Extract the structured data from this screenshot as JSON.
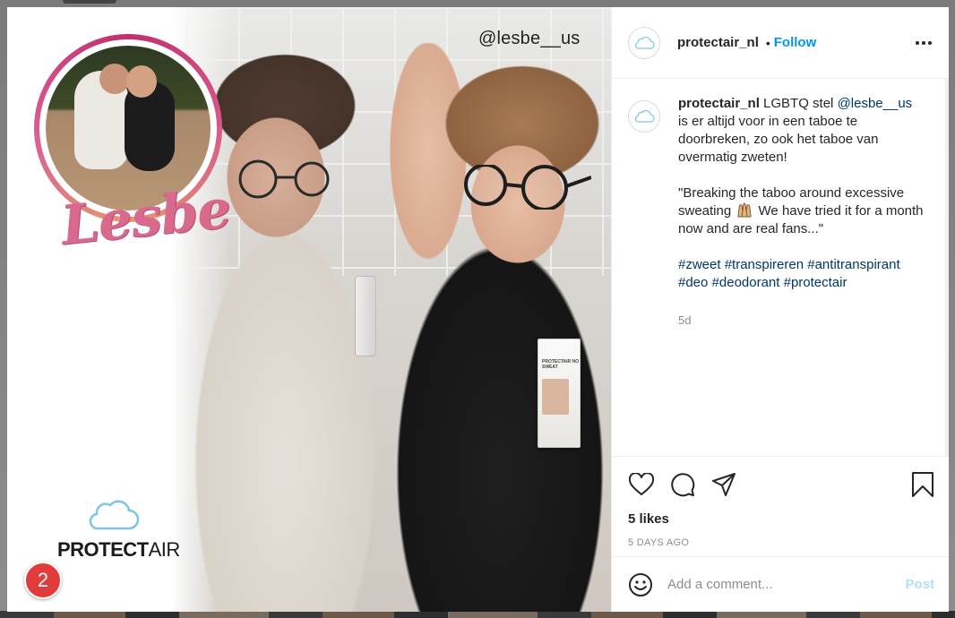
{
  "post": {
    "image": {
      "watermark_handle": "@lesbe__us",
      "badge_script_text": "Lesbe",
      "brand_name_bold": "PROTECT",
      "brand_name_thin": "AIR",
      "product_text": "PROTECTAIR NO SWEAT",
      "brand_cloud_icon": "cloud-icon"
    },
    "notification_count": "2"
  },
  "header": {
    "username": "protectair_nl",
    "separator": "•",
    "follow_label": "Follow",
    "more_icon": "more-options-icon"
  },
  "caption": {
    "username": "protectair_nl",
    "text_part1": " LGBTQ stel ",
    "mention": "@lesbe__us",
    "text_part2": " is er altijd voor in een taboe te doorbreken, zo ook het taboe van overmatig zweten!",
    "quote_part1": "\"Breaking the taboo around excessive sweating ",
    "quote_emoji": "raising-hands-icon",
    "quote_part2": " We have tried it for a month now and are real fans...\"",
    "hashtags": "#zweet #transpireren #antitranspirant #deo #deodorant #protectair",
    "timestamp": "5d"
  },
  "actions": {
    "like_icon": "heart-icon",
    "comment_icon": "comment-icon",
    "share_icon": "share-icon",
    "save_icon": "bookmark-icon",
    "likes": "5 likes",
    "date": "5 DAYS AGO"
  },
  "comment": {
    "emoji_icon": "smiley-icon",
    "placeholder": "Add a comment...",
    "post_label": "Post"
  },
  "colors": {
    "link_blue": "#0095f6",
    "mention_blue": "#00376b",
    "post_disabled": "#b2dffc",
    "badge_pink": "#d96a8e",
    "notification_red": "#e23b3b"
  }
}
